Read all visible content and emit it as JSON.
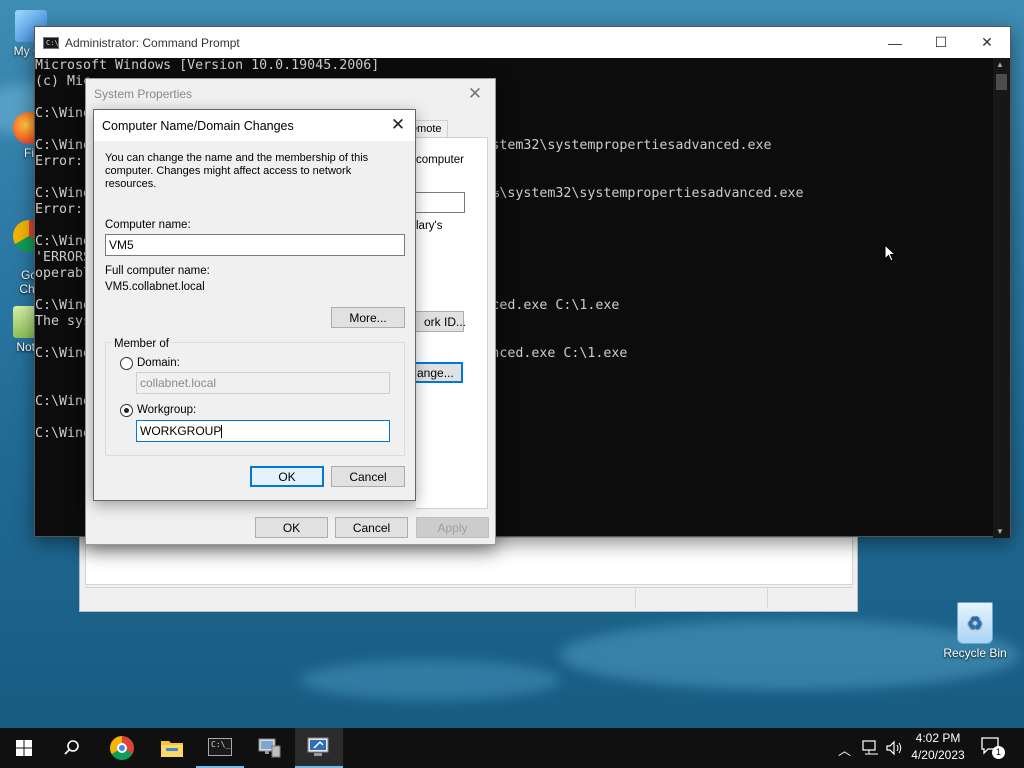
{
  "desktop": {
    "icons": [
      {
        "label": "My Co"
      },
      {
        "label": "Fi"
      },
      {
        "label": "Go\nChr"
      },
      {
        "label": "Note"
      },
      {
        "label": "Recycle Bin"
      }
    ]
  },
  "cmd": {
    "title": "Administrator: Command Prompt",
    "lines": [
      "Microsoft Windows [Version 10.0.19045.2006]",
      "(c) Mic",
      "",
      "C:\\Wind",
      "",
      "C:\\Wind                                            ir%\\system32\\systempropertiesadvanced.exe",
      "Error:",
      "",
      "C:\\Wind                                            windir%\\system32\\systempropertiesadvanced.exe",
      "Error:",
      "",
      "C:\\Wind",
      "'ERRORS                                            mand,",
      "operabl",
      "",
      "C:\\Wind                                            sadvanced.exe C:\\1.exe",
      "The sys",
      "",
      "C:\\Wind                                            esadvanced.exe C:\\1.exe",
      "",
      "",
      "C:\\Wind",
      "",
      "C:\\Wind"
    ]
  },
  "system_properties": {
    "title": "System Properties",
    "tab_remote": "Remote",
    "frag_computer": "computer",
    "frag_ary": "lary's",
    "network_id_button": "ork ID...",
    "change_button": "ange...",
    "ok": "OK",
    "cancel": "Cancel",
    "apply": "Apply"
  },
  "name_change_dialog": {
    "title": "Computer Name/Domain Changes",
    "description": "You can change the name and the membership of this computer. Changes might affect access to network resources.",
    "computer_name_label": "Computer name:",
    "computer_name_value": "VM5",
    "full_name_label": "Full computer name:",
    "full_name_value": "VM5.collabnet.local",
    "more_button": "More...",
    "member_of_label": "Member of",
    "domain_label": "Domain:",
    "domain_value": "collabnet.local",
    "workgroup_label": "Workgroup:",
    "workgroup_value": "WORKGROUP",
    "selected_membership": "workgroup",
    "ok": "OK",
    "cancel": "Cancel"
  },
  "taskbar": {
    "clock_time": "4:02 PM",
    "clock_date": "4/20/2023",
    "notification_count": "1"
  }
}
